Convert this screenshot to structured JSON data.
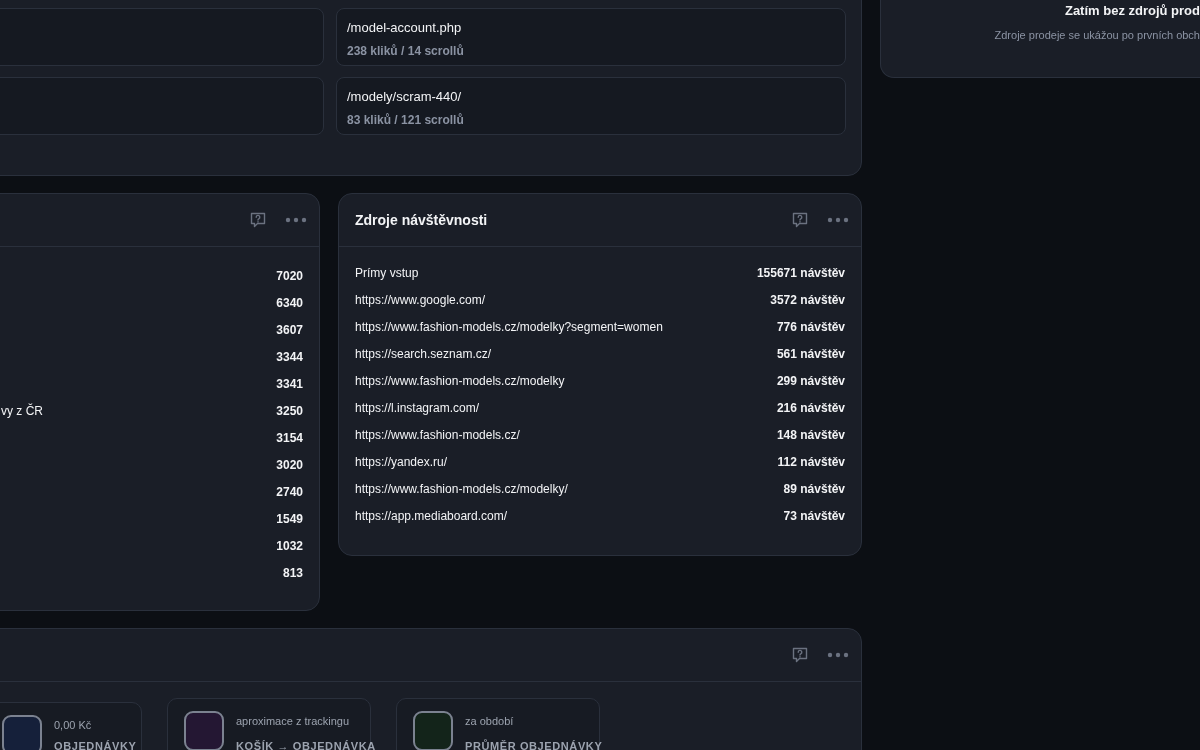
{
  "page_cards": [
    {
      "kind": "empty"
    },
    {
      "kind": "page",
      "path": "/model-account.php",
      "stats": "238 kliků / 14 scrollů"
    },
    {
      "kind": "empty"
    },
    {
      "kind": "page",
      "path": "/modely/scram-440/",
      "stats": "83 kliků / 121 scrollů"
    }
  ],
  "sales_sources": {
    "title": "Zatím bez zdrojů prod",
    "message": "Zdroje prodeje se ukážou po prvních obch"
  },
  "left_panel": {
    "rows": [
      {
        "value": "7020"
      },
      {
        "value": "6340"
      },
      {
        "value": "3607"
      },
      {
        "value": "3344"
      },
      {
        "value": "3341"
      },
      {
        "label": "vy z ČR",
        "value": "3250"
      },
      {
        "value": "3154"
      },
      {
        "value": "3020"
      },
      {
        "value": "2740"
      },
      {
        "value": "1549"
      },
      {
        "value": "1032"
      },
      {
        "value": "813"
      }
    ]
  },
  "traffic_sources": {
    "title": "Zdroje návštěvnosti",
    "rows": [
      {
        "label": "Prímy vstup",
        "value": "155671 návštěv"
      },
      {
        "label": "https://www.google.com/",
        "value": "3572 návštěv"
      },
      {
        "label": "https://www.fashion-models.cz/modelky?segment=women",
        "value": "776 návštěv"
      },
      {
        "label": "https://search.seznam.cz/",
        "value": "561 návštěv"
      },
      {
        "label": "https://www.fashion-models.cz/modelky",
        "value": "299 návštěv"
      },
      {
        "label": "https://l.instagram.com/",
        "value": "216 návštěv"
      },
      {
        "label": "https://www.fashion-models.cz/",
        "value": "148 návštěv"
      },
      {
        "label": "https://yandex.ru/",
        "value": "112 návštěv"
      },
      {
        "label": "https://www.fashion-models.cz/modelky/",
        "value": "89 návštěv"
      },
      {
        "label": "https://app.mediaboard.com/",
        "value": "73 návštěv"
      }
    ]
  },
  "kpi_cards": [
    {
      "caption": "0,00 Kč",
      "label": "OBJEDNÁVKY",
      "color": "#15203a"
    },
    {
      "caption": "aproximace z trackingu",
      "label": "KOŠÍK → OBJEDNÁVKA",
      "color": "#241733"
    },
    {
      "caption": "za období",
      "label": "PRŮMĚR OBJEDNÁVKY",
      "color": "#13241a"
    }
  ]
}
